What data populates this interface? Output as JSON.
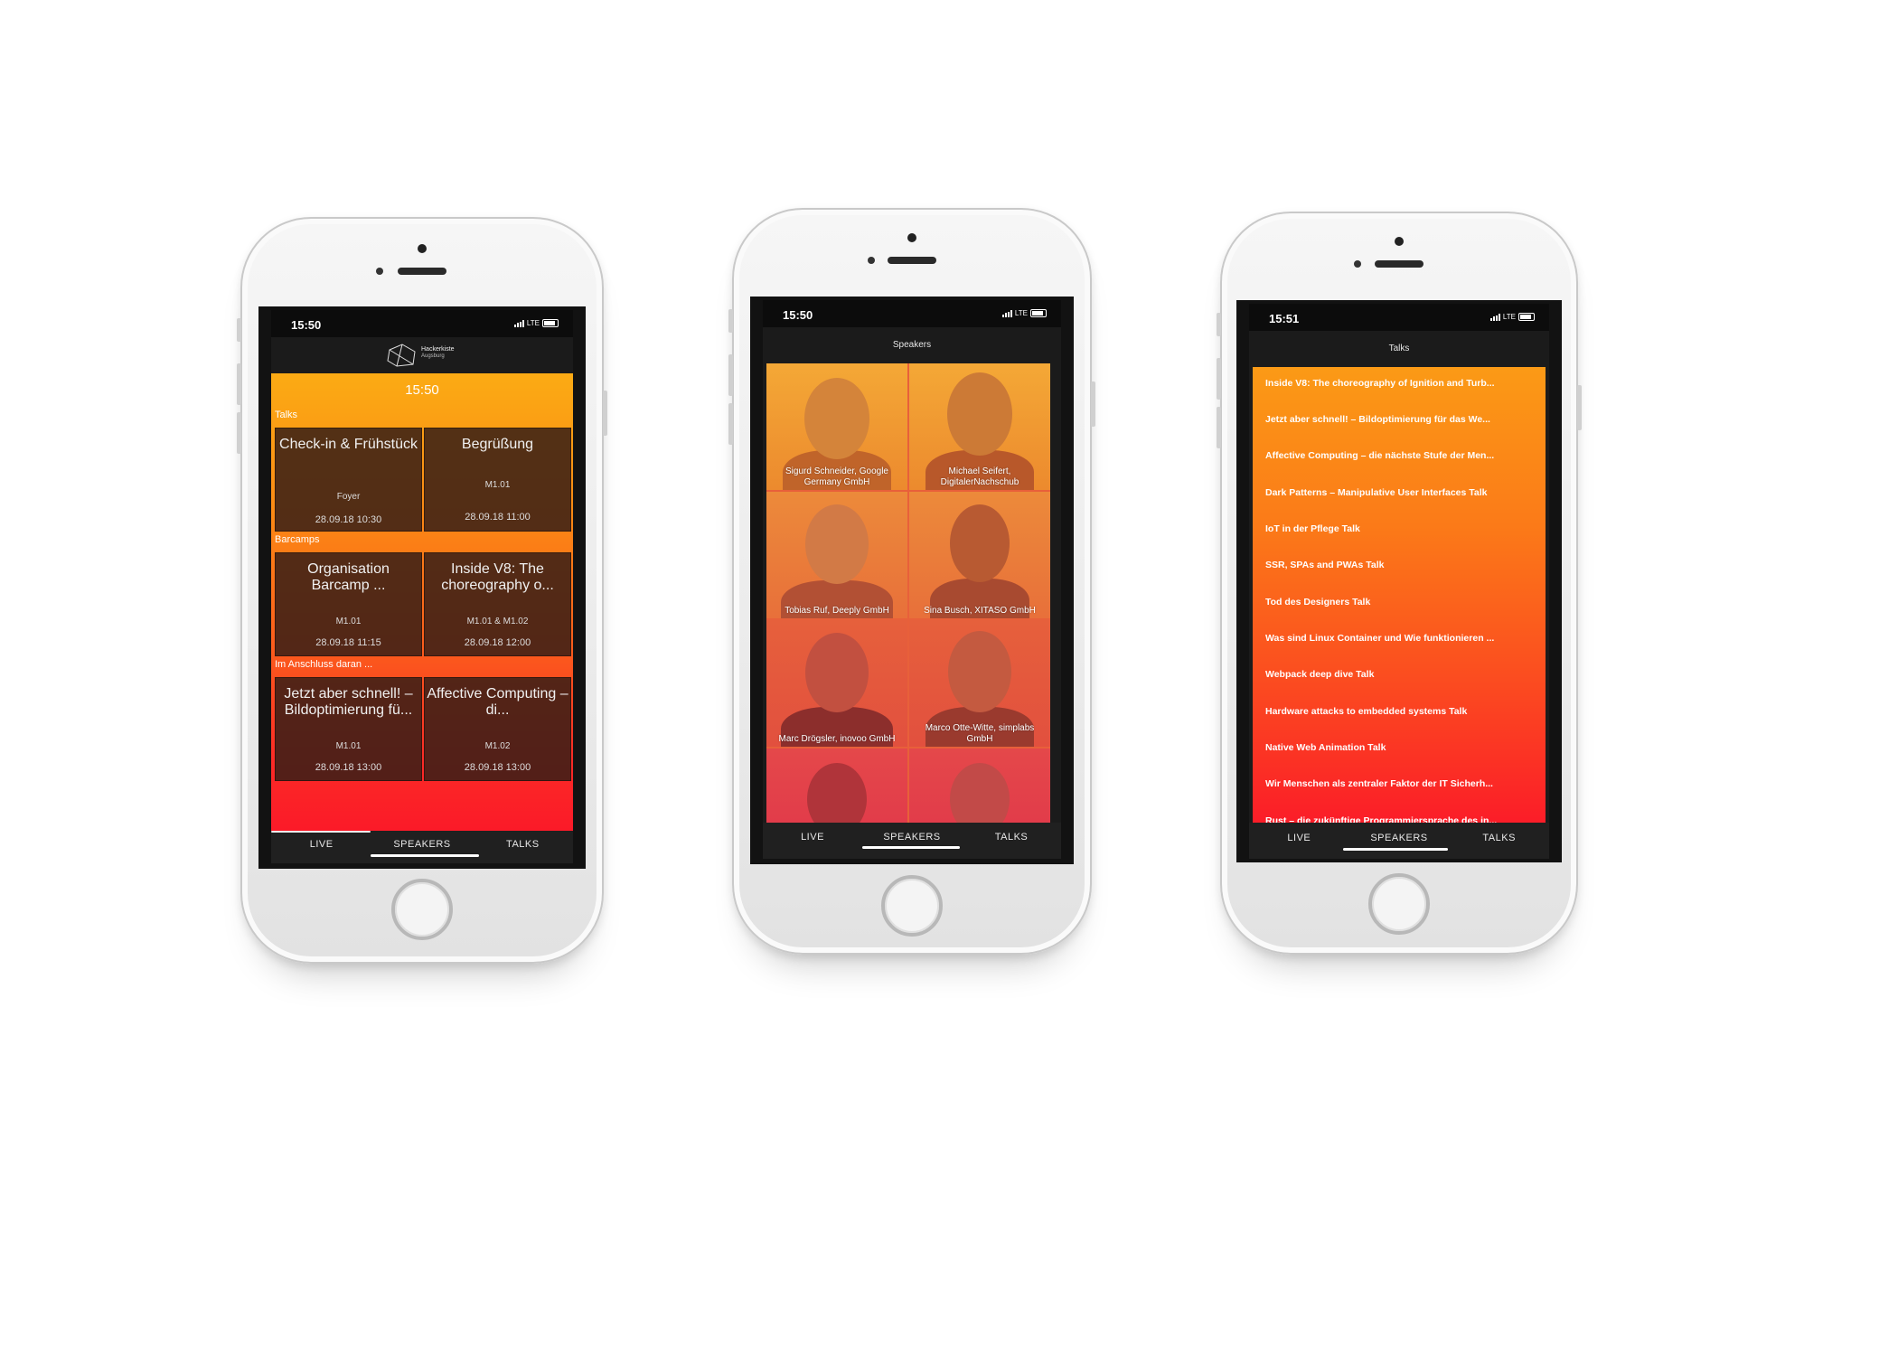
{
  "phone1": {
    "status_time": "15:50",
    "status_network": "LTE",
    "logo_line1": "Hackerkiste",
    "logo_line2": "Augsburg",
    "live_time": "15:50",
    "sections": [
      {
        "label": "Talks"
      },
      {
        "label": "Barcamps"
      },
      {
        "label": "Im Anschluss daran ..."
      }
    ],
    "cards": [
      {
        "title": "Check-in & Frühstück",
        "room": "Foyer",
        "date": "28.09.18 10:30"
      },
      {
        "title": "Begrüßung",
        "room": "M1.01",
        "date": "28.09.18 11:00"
      },
      {
        "title": "Organisation Barcamp ...",
        "room": "M1.01",
        "date": "28.09.18 11:15"
      },
      {
        "title": "Inside V8: The choreography o...",
        "room": "M1.01 & M1.02",
        "date": "28.09.18 12:00"
      },
      {
        "title": "Jetzt aber schnell! – Bildoptimierung fü...",
        "room": "M1.01",
        "date": "28.09.18 13:00"
      },
      {
        "title": "Affective Computing – di...",
        "room": "M1.02",
        "date": "28.09.18 13:00"
      }
    ],
    "tabs": [
      "LIVE",
      "SPEAKERS",
      "TALKS"
    ]
  },
  "phone2": {
    "status_time": "15:50",
    "status_network": "LTE",
    "title": "Speakers",
    "speakers": [
      {
        "name": "Sigurd Schneider, Google Germany GmbH"
      },
      {
        "name": "Michael Seifert, DigitalerNachschub"
      },
      {
        "name": "Tobias Ruf, Deeply GmbH"
      },
      {
        "name": "Sina Busch, XITASO GmbH"
      },
      {
        "name": "Marc Drögsler, inovoo GmbH"
      },
      {
        "name": "Marco Otte-Witte, simplabs GmbH"
      },
      {
        "name": ""
      },
      {
        "name": ""
      }
    ],
    "tabs": [
      "LIVE",
      "SPEAKERS",
      "TALKS"
    ]
  },
  "phone3": {
    "status_time": "15:51",
    "status_network": "LTE",
    "title": "Talks",
    "talks": [
      "Inside V8: The choreography of Ignition and Turb...",
      "Jetzt aber schnell! – Bildoptimierung für das We...",
      "Affective Computing – die nächste Stufe der Men...",
      "Dark Patterns – Manipulative User Interfaces Talk",
      "IoT in der Pflege Talk",
      "SSR, SPAs and PWAs Talk",
      "Tod des Designers Talk",
      "Was sind Linux Container und Wie funktionieren ...",
      "Webpack deep dive Talk",
      "Hardware attacks to embedded systems Talk",
      "Native Web Animation Talk",
      "Wir Menschen als zentraler Faktor der IT Sicherh...",
      "Rust – die zukünftige Programmiersprache des in..."
    ],
    "tabs": [
      "LIVE",
      "SPEAKERS",
      "TALKS"
    ]
  }
}
